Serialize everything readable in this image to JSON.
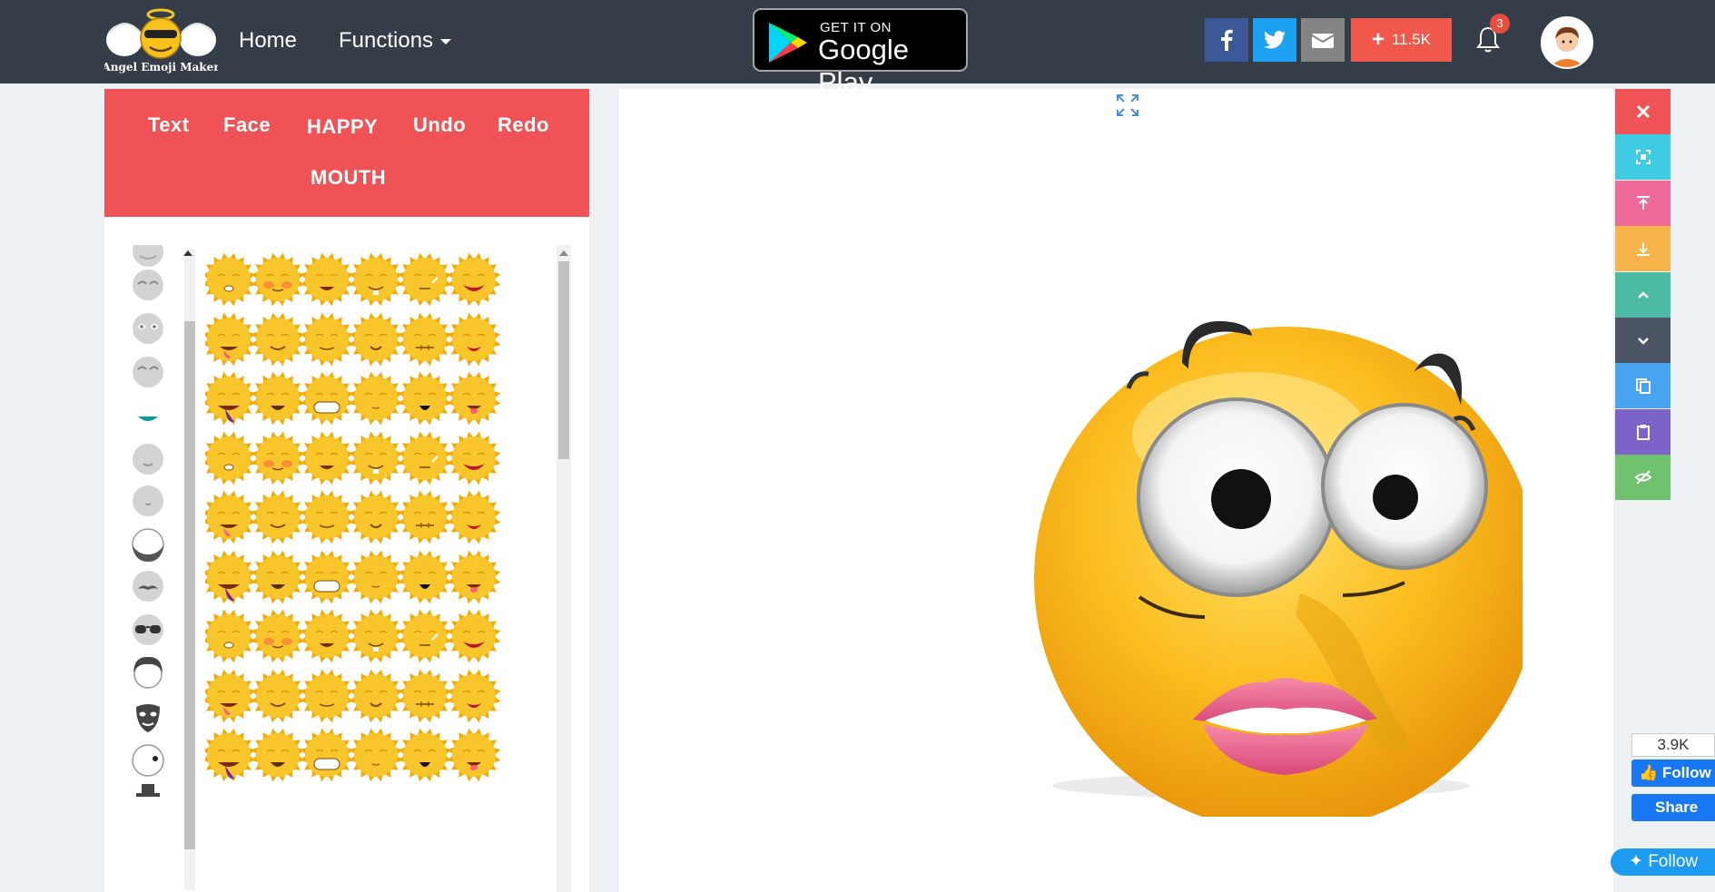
{
  "header": {
    "home_label": "Home",
    "functions_label": "Functions",
    "gplay_small": "GET IT ON",
    "gplay_big": "Google Play",
    "share_count": "11.5K",
    "notification_count": "3",
    "colors": {
      "bar": "#343d48",
      "facebook": "#3b5998",
      "twitter": "#1da1f2",
      "mail": "#848484",
      "plus": "#f0584c"
    }
  },
  "logo_text": "Angel Emoji Maker",
  "toolbar": {
    "text": "Text",
    "face": "Face",
    "happy": "HAPPY",
    "undo": "Undo",
    "redo": "Redo",
    "mouth": "MOUTH",
    "color": "#ef5355"
  },
  "categories": [
    "partial-top",
    "closed-eyes",
    "open-eyes",
    "closed-eyes-2",
    "mouth-teal",
    "nose",
    "chin",
    "beard",
    "mustache",
    "sunglasses",
    "hair",
    "mask",
    "accessory",
    "hat"
  ],
  "emoji_grid": {
    "rows": 9,
    "cols": 6,
    "style": "sun-face"
  },
  "tools": [
    {
      "name": "close",
      "color": "#ef5355"
    },
    {
      "name": "center",
      "color": "#3fcbe3"
    },
    {
      "name": "bring-to-front",
      "color": "#ef6a9a"
    },
    {
      "name": "send-to-back",
      "color": "#f6b44a"
    },
    {
      "name": "move-up",
      "color": "#4dbba3"
    },
    {
      "name": "move-down",
      "color": "#4c5565"
    },
    {
      "name": "copy",
      "color": "#4aa3f1"
    },
    {
      "name": "paste",
      "color": "#7b63c9"
    },
    {
      "name": "hide",
      "color": "#6fc16d"
    }
  ],
  "social": {
    "fb_count": "3.9K",
    "fb_follow": "Follow",
    "fb_share": "Share",
    "tw_follow": "Follow"
  }
}
